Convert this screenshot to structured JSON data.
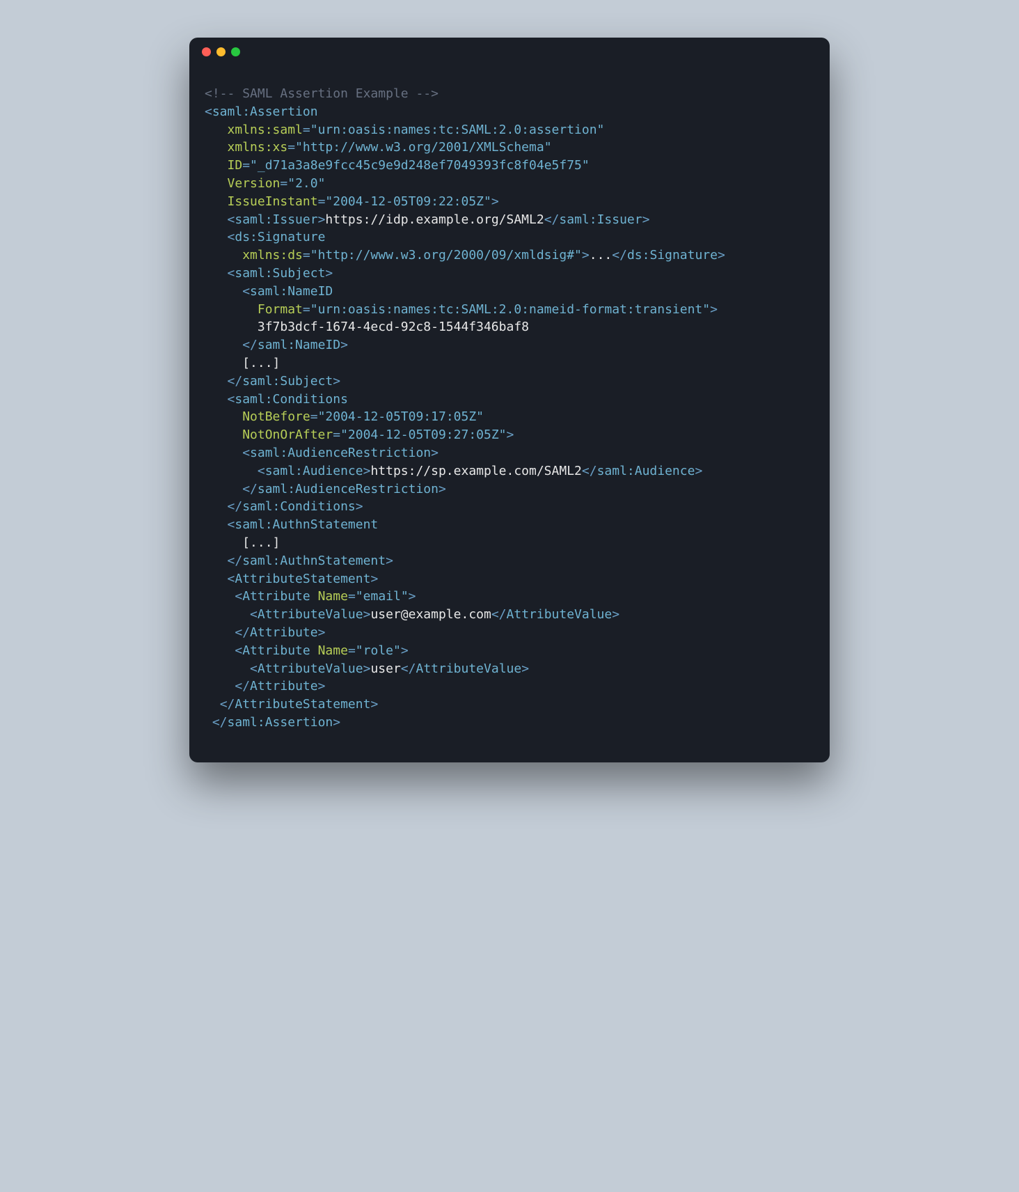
{
  "code": {
    "comment": "SAML Assertion Example",
    "root_tag": "saml:Assertion",
    "attrs": {
      "xmlns_saml_name": "xmlns:saml",
      "xmlns_saml_val": "urn:oasis:names:tc:SAML:2.0:assertion",
      "xmlns_xs_name": "xmlns:xs",
      "xmlns_xs_val": "http://www.w3.org/2001/XMLSchema",
      "id_name": "ID",
      "id_val": "_d71a3a8e9fcc45c9e9d248ef7049393fc8f04e5f75",
      "ver_name": "Version",
      "ver_val": "2.0",
      "issue_name": "IssueInstant",
      "issue_val": "2004-12-05T09:22:05Z"
    },
    "issuer": {
      "tag": "saml:Issuer",
      "text": "https://idp.example.org/SAML2"
    },
    "signature": {
      "tag": "ds:Signature",
      "attr_name": "xmlns:ds",
      "attr_val": "http://www.w3.org/2000/09/xmldsig#",
      "text": "..."
    },
    "subject": {
      "tag": "saml:Subject",
      "nameid_tag": "saml:NameID",
      "nameid_attr_name": "Format",
      "nameid_attr_val": "urn:oasis:names:tc:SAML:2.0:nameid-format:transient",
      "nameid_text": "3f7b3dcf-1674-4ecd-92c8-1544f346baf8",
      "ellipsis": "[...]"
    },
    "conditions": {
      "tag": "saml:Conditions",
      "nb_name": "NotBefore",
      "nb_val": "2004-12-05T09:17:05Z",
      "na_name": "NotOnOrAfter",
      "na_val": "2004-12-05T09:27:05Z",
      "ar_tag": "saml:AudienceRestriction",
      "aud_tag": "saml:Audience",
      "aud_text": "https://sp.example.com/SAML2"
    },
    "authn": {
      "tag": "saml:AuthnStatement",
      "ellipsis": "[...]"
    },
    "attrstmt": {
      "tag": "AttributeStatement",
      "attr_tag": "Attribute",
      "name_attr": "Name",
      "av_tag": "AttributeValue",
      "a1_name": "email",
      "a1_val": "user@example.com",
      "a2_name": "role",
      "a2_val": "user"
    }
  }
}
